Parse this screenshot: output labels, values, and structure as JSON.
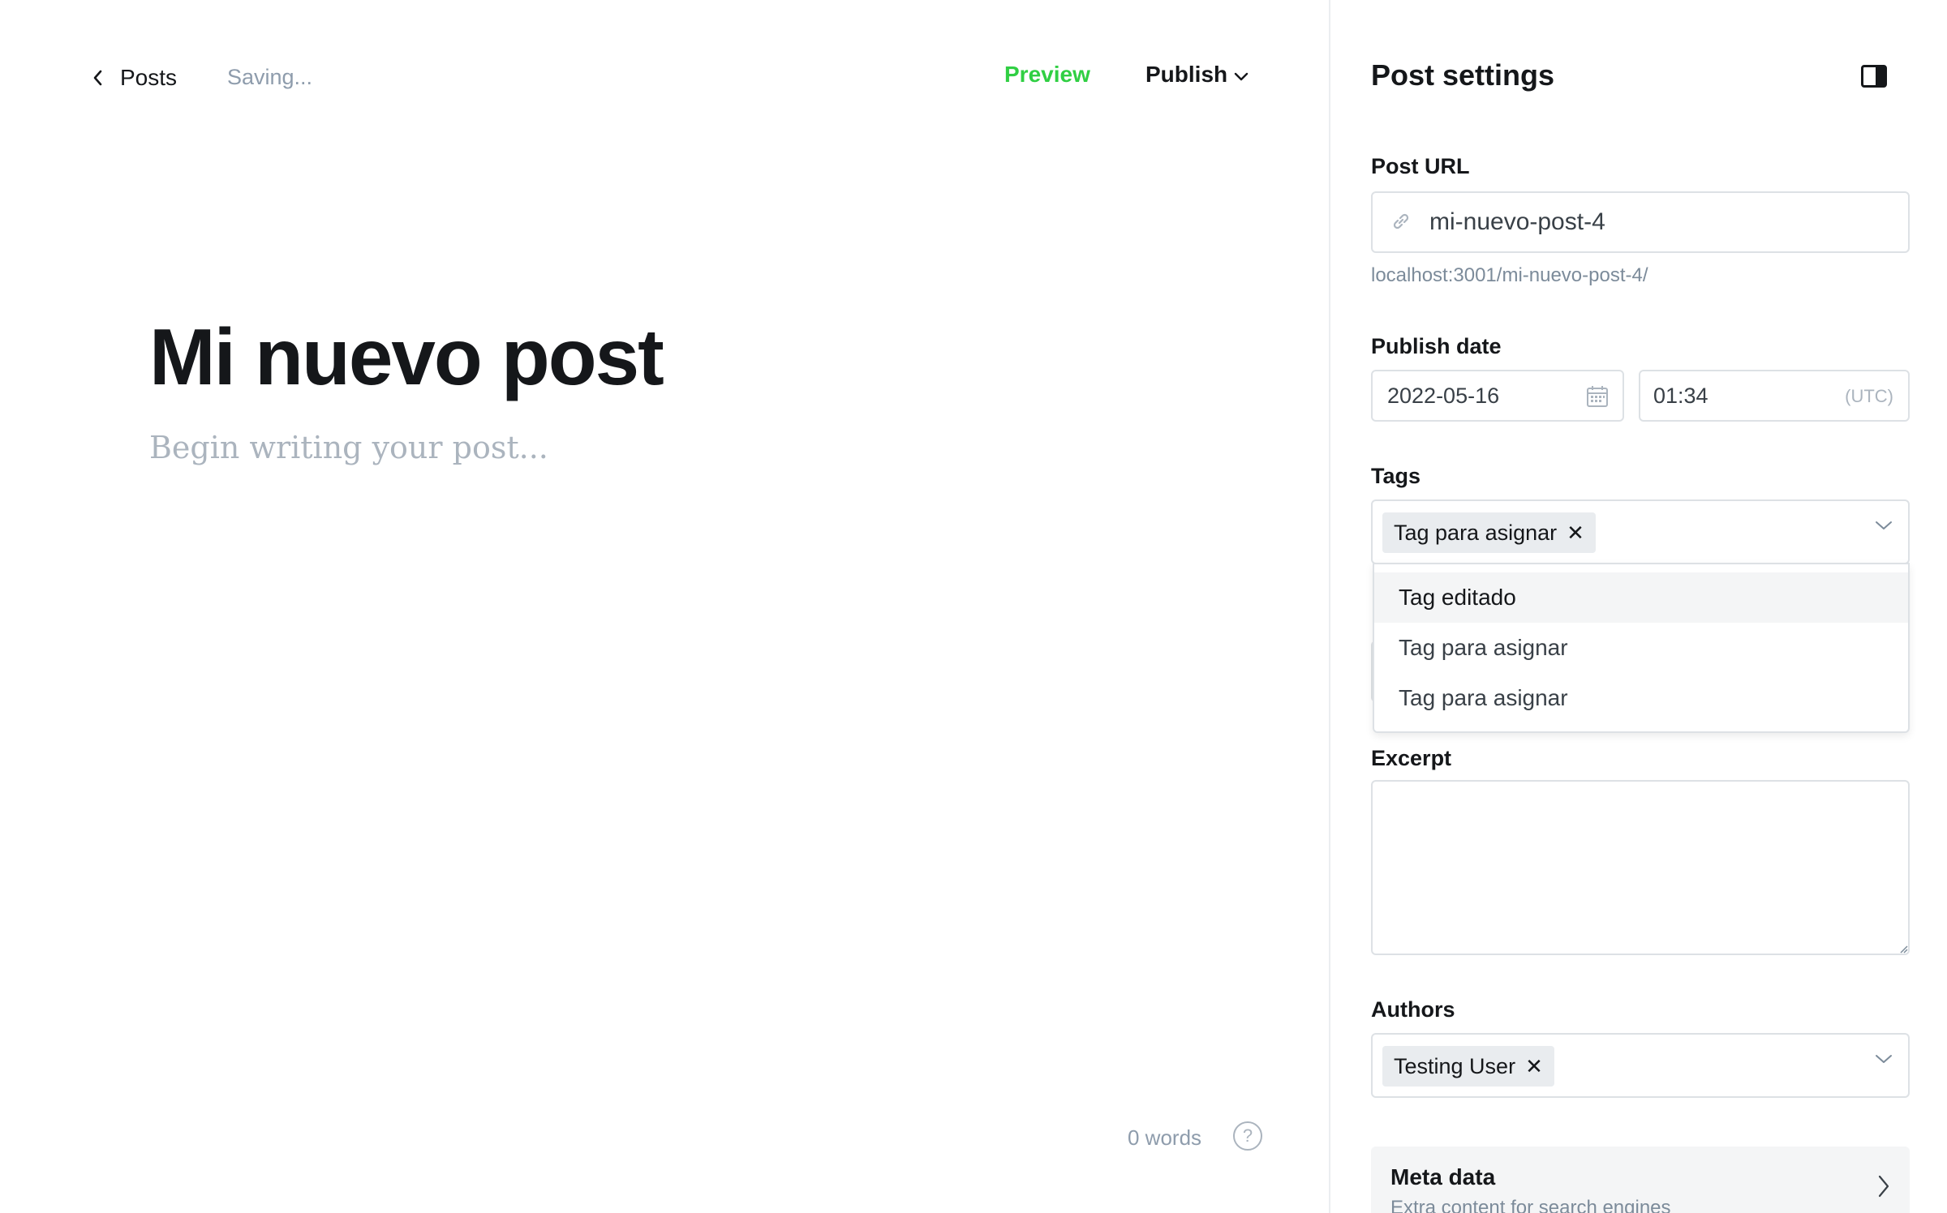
{
  "editor": {
    "back_label": "Posts",
    "status": "Saving...",
    "preview_label": "Preview",
    "publish_label": "Publish",
    "title": "Mi nuevo post",
    "body_placeholder": "Begin writing your post...",
    "word_count": "0 words",
    "help_label": "?"
  },
  "settings": {
    "title": "Post settings",
    "post_url": {
      "label": "Post URL",
      "value": "mi-nuevo-post-4",
      "hint": "localhost:3001/mi-nuevo-post-4/"
    },
    "publish_date": {
      "label": "Publish date",
      "date": "2022-05-16",
      "time": "01:34",
      "timezone": "(UTC)"
    },
    "tags": {
      "label": "Tags",
      "selected": [
        "Tag para asignar"
      ],
      "dropdown_options": [
        "Tag editado",
        "Tag para asignar",
        "Tag para asignar"
      ]
    },
    "excerpt": {
      "label": "Excerpt",
      "value": ""
    },
    "authors": {
      "label": "Authors",
      "selected": [
        "Testing User"
      ]
    },
    "meta_data": {
      "title": "Meta data",
      "subtitle": "Extra content for search engines"
    }
  },
  "colors": {
    "accent_green": "#30cf43",
    "text_dark": "#15171a",
    "muted": "#8e9cac",
    "border": "#dde1e5",
    "token_bg": "#e9ecef"
  },
  "icons": {
    "back": "chevron-left-icon",
    "publish_dropdown": "chevron-down-icon",
    "panel": "sidebar-toggle-icon",
    "url": "link-icon",
    "date": "calendar-icon",
    "tags_dropdown": "chevron-down-icon",
    "meta": "chevron-right-icon",
    "help": "question-circle-icon"
  }
}
